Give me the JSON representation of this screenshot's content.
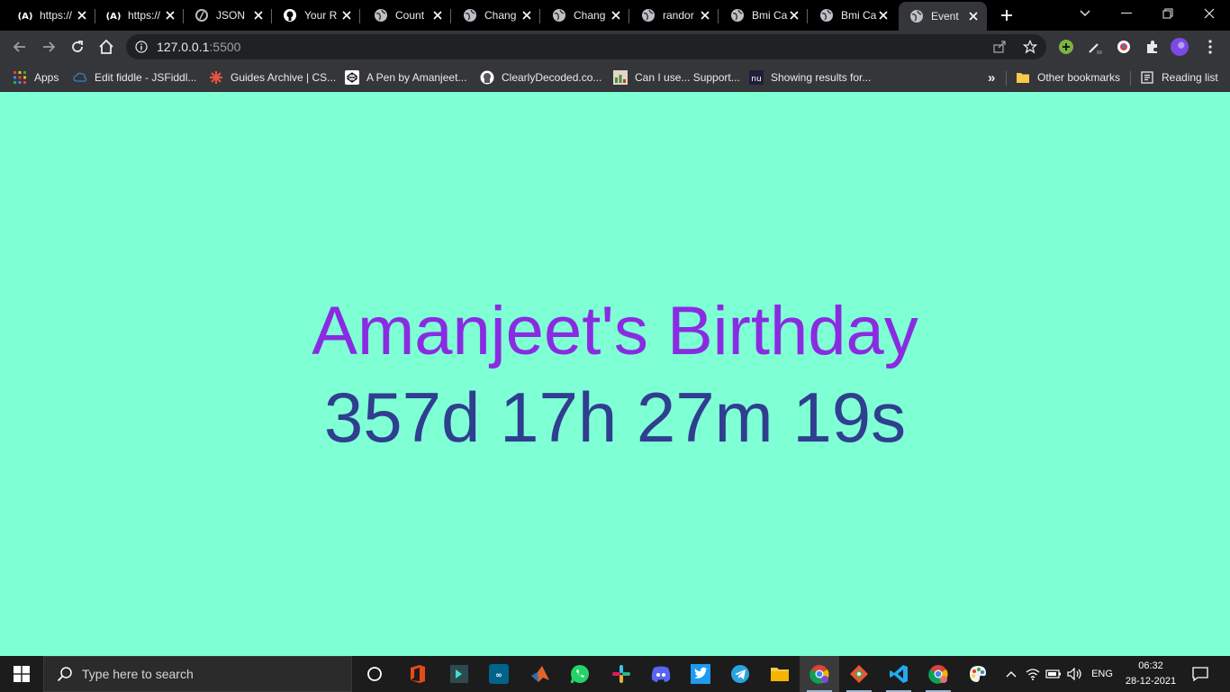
{
  "tabs": [
    {
      "title": "https://",
      "icon": "vite-icon"
    },
    {
      "title": "https://",
      "icon": "vite-icon"
    },
    {
      "title": "JSON",
      "icon": "json-icon"
    },
    {
      "title": "Your R",
      "icon": "github-icon"
    },
    {
      "title": "Count",
      "icon": "globe-icon"
    },
    {
      "title": "Chang",
      "icon": "globe-icon"
    },
    {
      "title": "Chang",
      "icon": "globe-icon"
    },
    {
      "title": "randor",
      "icon": "globe-icon"
    },
    {
      "title": "Bmi Ca",
      "icon": "globe-icon"
    },
    {
      "title": "Bmi Ca",
      "icon": "globe-icon"
    },
    {
      "title": "Event",
      "icon": "globe-icon",
      "active": true
    }
  ],
  "address_bar": {
    "host": "127.0.0.1",
    "port": ":5500"
  },
  "bookmarks": [
    {
      "label": "Apps"
    },
    {
      "label": "Edit fiddle - JSFiddl..."
    },
    {
      "label": "Guides Archive | CS..."
    },
    {
      "label": "A Pen by Amanjeet..."
    },
    {
      "label": "ClearlyDecoded.co..."
    },
    {
      "label": "Can I use... Support..."
    },
    {
      "label": "Showing results for..."
    }
  ],
  "bookmarks_overflow": "»",
  "other_bookmarks": "Other bookmarks",
  "reading_list": "Reading list",
  "page": {
    "event_name": "Amanjeet's Birthday",
    "countdown": "357d 17h 27m 19s",
    "background_color": "#7fffd4",
    "title_color": "#8a2be2",
    "countdown_color": "#2f3e8f"
  },
  "taskbar": {
    "search_placeholder": "Type here to search",
    "language": "ENG",
    "time": "06:32",
    "date": "28-12-2021"
  }
}
